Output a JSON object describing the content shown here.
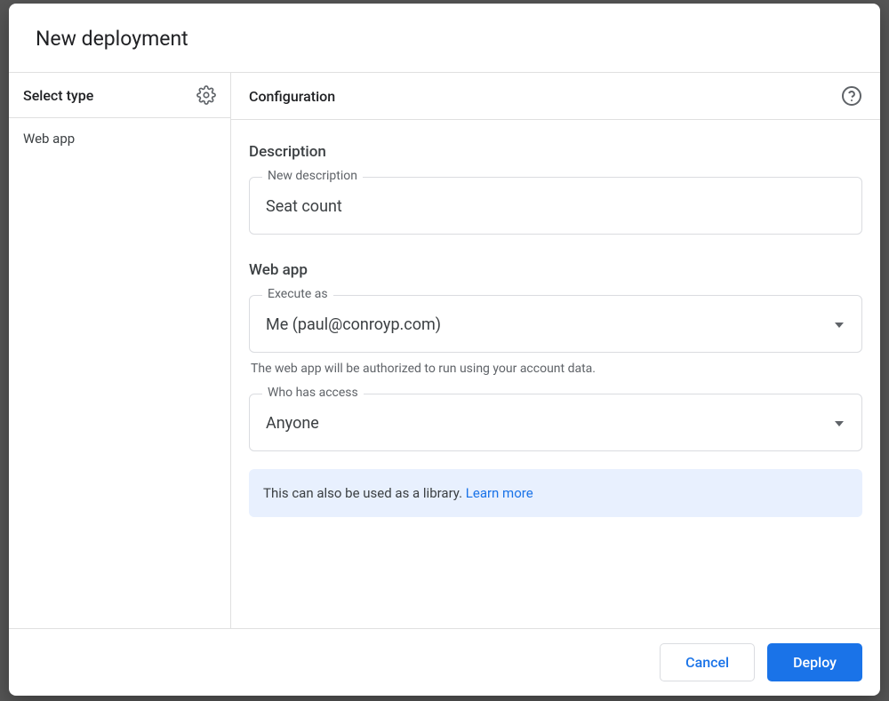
{
  "dialog": {
    "title": "New deployment"
  },
  "sidebar": {
    "title": "Select type",
    "items": [
      {
        "label": "Web app"
      }
    ]
  },
  "config": {
    "title": "Configuration",
    "description_heading": "Description",
    "description_field": {
      "label": "New description",
      "value": "Seat count"
    },
    "webapp_heading": "Web app",
    "execute_as": {
      "label": "Execute as",
      "value": "Me (paul@conroyp.com)",
      "helper": "The web app will be authorized to run using your account data."
    },
    "access": {
      "label": "Who has access",
      "value": "Anyone"
    },
    "info_banner": {
      "text": "This can also be used as a library. ",
      "link_text": "Learn more"
    }
  },
  "footer": {
    "cancel": "Cancel",
    "deploy": "Deploy"
  }
}
